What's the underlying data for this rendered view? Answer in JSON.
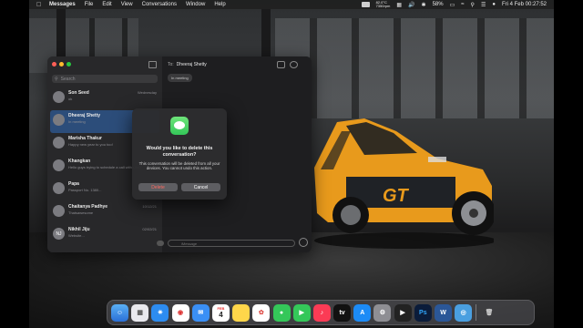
{
  "menubar": {
    "app": "Messages",
    "menus": [
      "File",
      "Edit",
      "View",
      "Conversations",
      "Window",
      "Help"
    ],
    "battery_stat_top": "82.0°C",
    "battery_stat_bottom": "7350rpm",
    "battery_percent": "58%",
    "datetime": "Fri 4 Feb  00:27:52"
  },
  "sidebar": {
    "search_placeholder": "Search",
    "conversations": [
      {
        "name": "Son Seed",
        "time": "Wednesday",
        "preview": "ok",
        "initials": ""
      },
      {
        "name": "Dheeraj Shetty",
        "time": "",
        "preview": "In meeting",
        "initials": ""
      },
      {
        "name": "Marisha Thakur",
        "time": "",
        "preview": "Happy new year to you too!",
        "initials": ""
      },
      {
        "name": "Khangkan",
        "time": "",
        "preview": "Hello guys trying to schedule a call with UMO",
        "initials": ""
      },
      {
        "name": "Papa",
        "time": "",
        "preview": "Passport No. 1380...",
        "initials": ""
      },
      {
        "name": "Chaitanya Padhye",
        "time": "10/12/21",
        "preview": "Thatsawesome",
        "initials": ""
      },
      {
        "name": "Nikhil Jiju",
        "time": "02/02/21",
        "preview": "Website...",
        "initials": "NJ"
      }
    ]
  },
  "chat": {
    "to_label": "To:",
    "to_name": "Dheeraj Shetty",
    "status_chip": "In meeting",
    "input_placeholder": "iMessage"
  },
  "dialog": {
    "title": "Would you like to delete this conversation?",
    "message": "This conversation will be deleted from all your devices. You cannot undo this action.",
    "delete_label": "Delete",
    "cancel_label": "Cancel"
  },
  "dock": {
    "calendar_month": "FEB",
    "calendar_day": "4"
  },
  "colors": {
    "accent_selected": "#2c4d7a",
    "messages_green": "#34c759",
    "car_orange": "#f0a020"
  }
}
